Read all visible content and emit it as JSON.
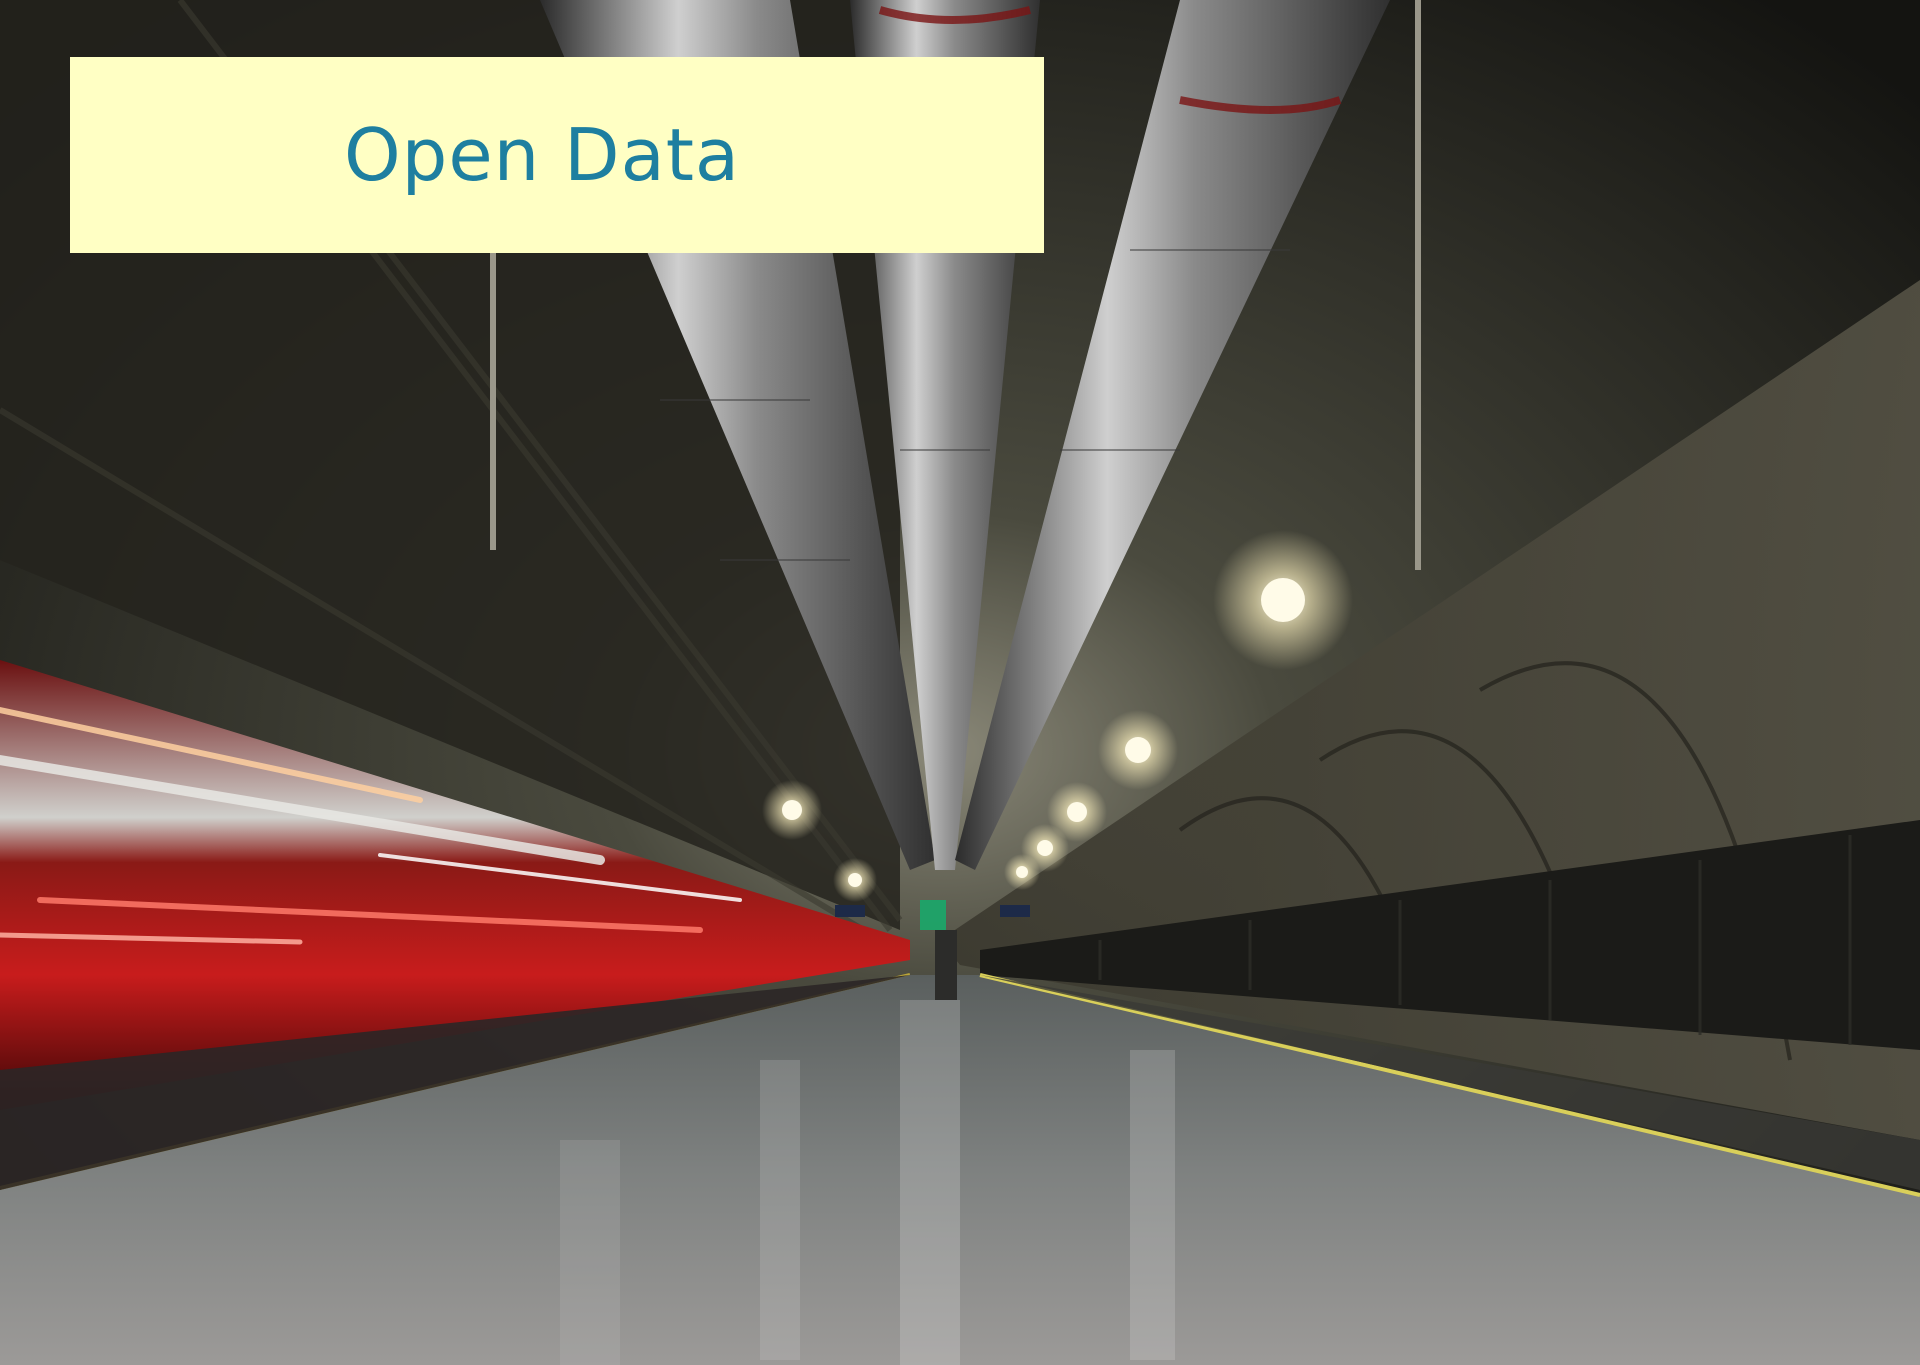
{
  "banner": {
    "title": "Open Data"
  },
  "colors": {
    "banner_background": "#ffffc4",
    "banner_text": "#1e7fa0",
    "train_red": "#b0141a",
    "light": "#fffbe8"
  },
  "photo": {
    "icons": [
      "train-icon",
      "ceiling-light-icon",
      "ventilation-duct-icon"
    ]
  }
}
